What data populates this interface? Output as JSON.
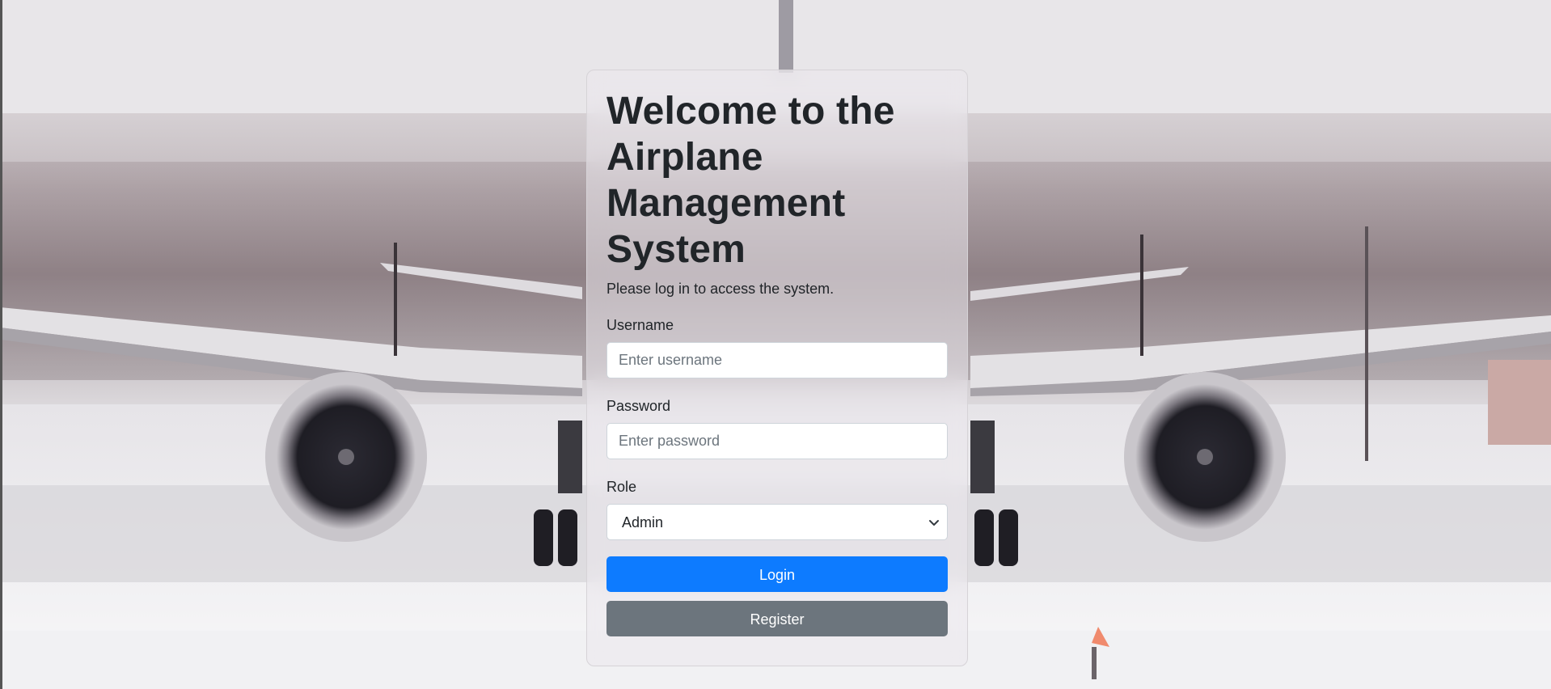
{
  "background": {
    "image_icon": "airplane-snow-runway-photo"
  },
  "login": {
    "title": "Welcome to the Airplane Management System",
    "subtitle": "Please log in to access the system.",
    "username": {
      "label": "Username",
      "value": "",
      "placeholder": "Enter username"
    },
    "password": {
      "label": "Password",
      "value": "",
      "placeholder": "Enter password"
    },
    "role": {
      "label": "Role",
      "selected": "Admin",
      "icon": "chevron-down-icon"
    },
    "login_button": "Login",
    "register_button": "Register"
  },
  "colors": {
    "primary": "#0d7bff",
    "secondary": "#6c757d",
    "text": "#212529"
  }
}
